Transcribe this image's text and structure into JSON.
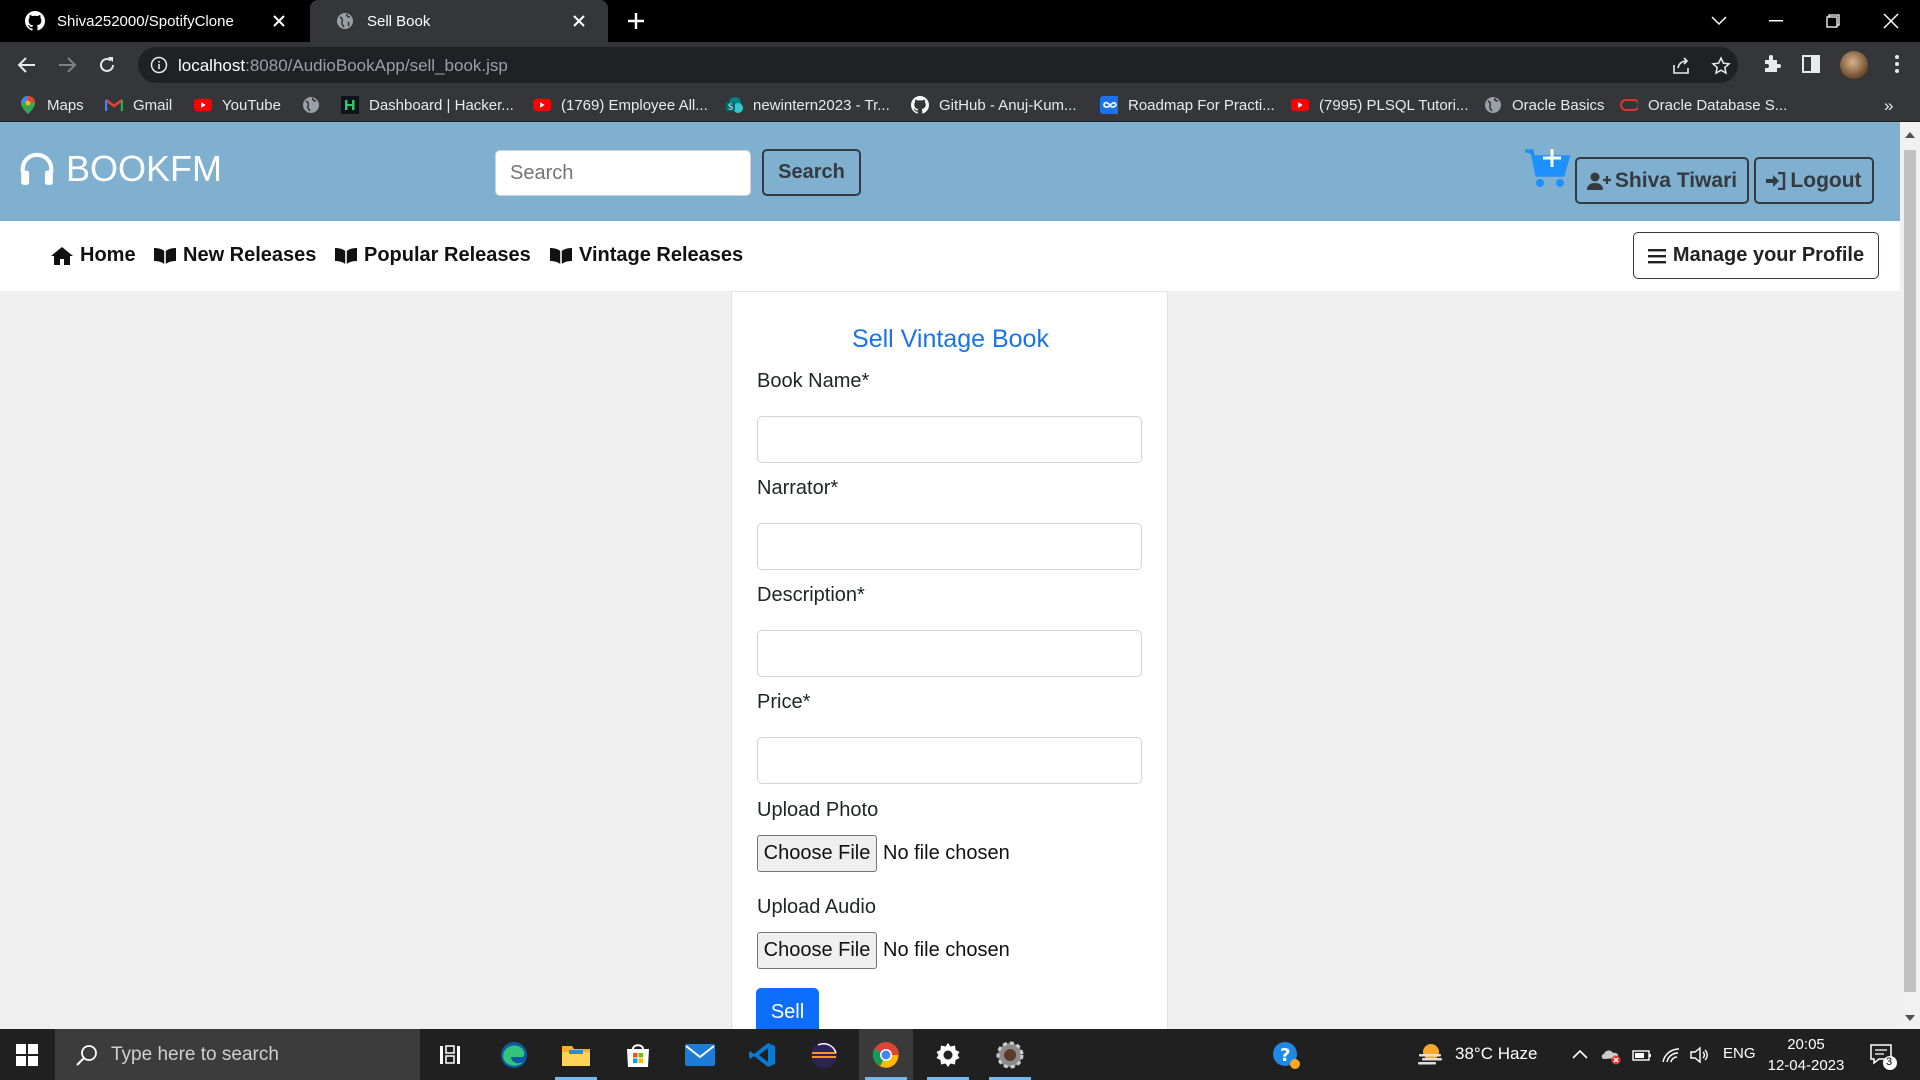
{
  "browser": {
    "tabs": [
      {
        "title": "Shiva252000/SpotifyClone",
        "icon": "github-icon",
        "active": false
      },
      {
        "title": "Sell Book",
        "icon": "globe-icon",
        "active": true
      }
    ],
    "url_host": "localhost",
    "url_rest": ":8080/AudioBookApp/sell_book.jsp",
    "bookmarks": [
      {
        "label": "Maps",
        "icon": "maps-icon"
      },
      {
        "label": "Gmail",
        "icon": "gmail-icon"
      },
      {
        "label": "YouTube",
        "icon": "youtube-icon"
      },
      {
        "label": "",
        "icon": "globe-icon"
      },
      {
        "label": "Dashboard | Hacker...",
        "icon": "hackerrank-icon"
      },
      {
        "label": "(1769) Employee All...",
        "icon": "youtube-icon"
      },
      {
        "label": "newintern2023 - Tr...",
        "icon": "sharepoint-icon"
      },
      {
        "label": "GitHub - Anuj-Kum...",
        "icon": "github-icon"
      },
      {
        "label": "Roadmap For Practi...",
        "icon": "infinity-icon"
      },
      {
        "label": "(7995) PLSQL Tutori...",
        "icon": "youtube-icon"
      },
      {
        "label": "Oracle Basics",
        "icon": "globe-icon"
      },
      {
        "label": "Oracle Database S...",
        "icon": "oracle-icon"
      }
    ],
    "more_bookmarks": "»"
  },
  "site": {
    "brand": "BOOKFM",
    "search_placeholder": "Search",
    "search_button": "Search",
    "user_button": "Shiva Tiwari",
    "logout_button": "Logout",
    "nav": [
      {
        "label": "Home",
        "icon": "home-icon"
      },
      {
        "label": "New Releases",
        "icon": "book-open-icon"
      },
      {
        "label": "Popular Releases",
        "icon": "book-open-icon"
      },
      {
        "label": "Vintage Releases",
        "icon": "book-open-icon"
      }
    ],
    "profile_button": "Manage your Profile",
    "colors": {
      "header": "#7fb0cf",
      "primary": "#0d6efd",
      "title": "#1a73e8"
    }
  },
  "form": {
    "title": "Sell Vintage Book",
    "book_name_label": "Book Name*",
    "book_name_value": "",
    "narrator_label": "Narrator*",
    "narrator_value": "",
    "description_label": "Description*",
    "description_value": "",
    "price_label": "Price*",
    "price_value": "",
    "photo_label": "Upload Photo",
    "audio_label": "Upload Audio",
    "choose_file": "Choose File",
    "no_file": "No file chosen",
    "submit": "Sell"
  },
  "taskbar": {
    "search_placeholder": "Type here to search",
    "weather": "38°C  Haze",
    "language": "ENG",
    "time": "20:05",
    "date": "12-04-2023",
    "notifications": "3"
  }
}
